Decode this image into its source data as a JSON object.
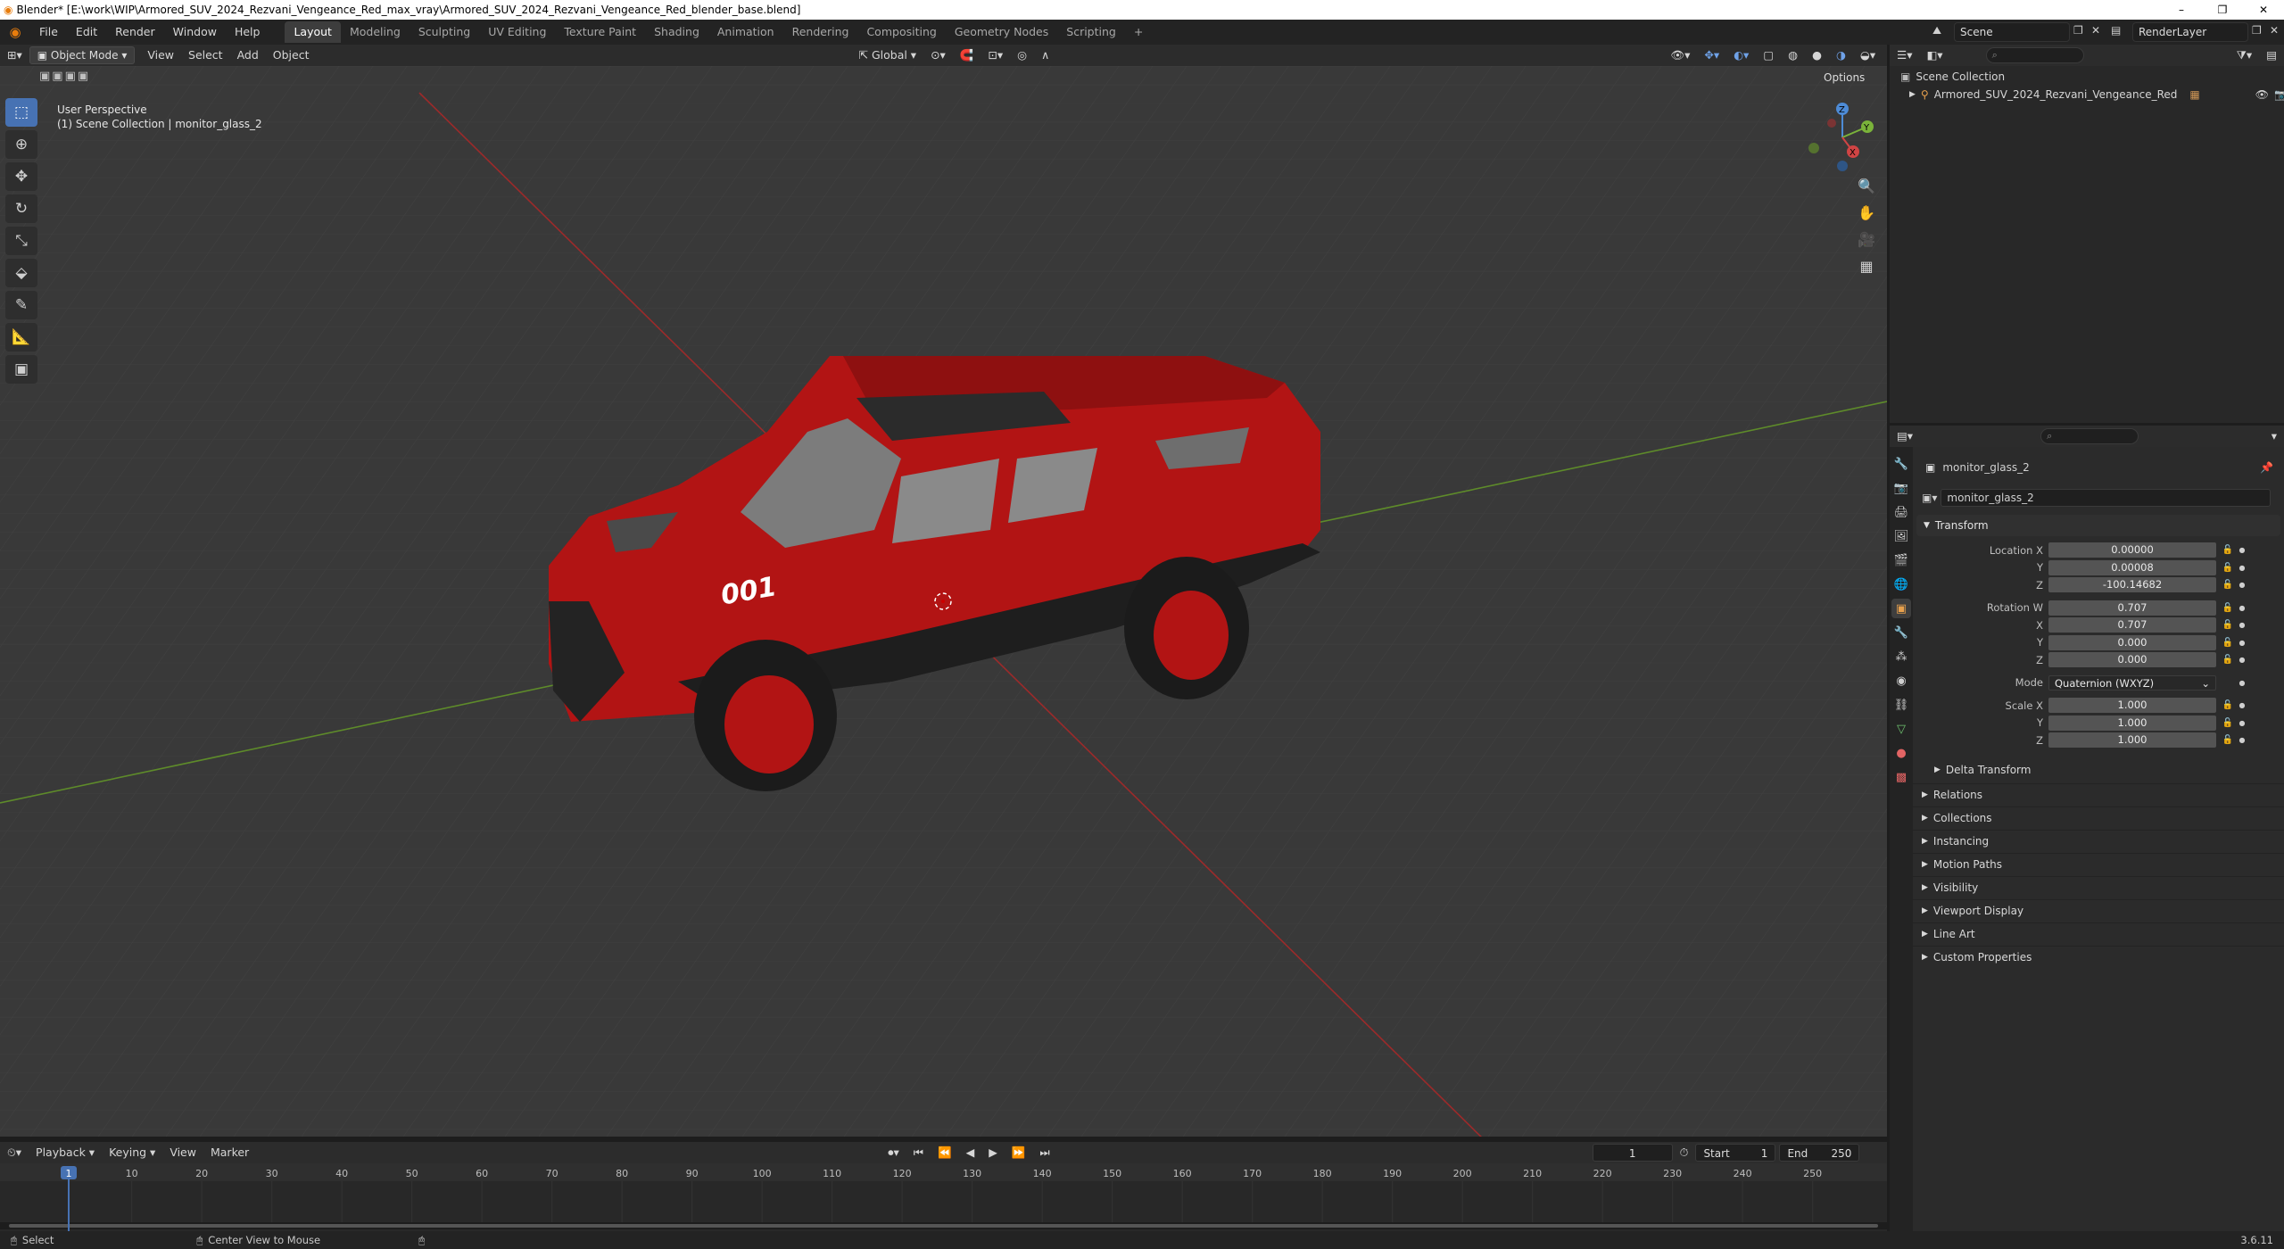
{
  "window": {
    "title": "Blender* [E:\\work\\WIP\\Armored_SUV_2024_Rezvani_Vengeance_Red_max_vray\\Armored_SUV_2024_Rezvani_Vengeance_Red_blender_base.blend]",
    "minimize": "–",
    "restore": "❐",
    "close": "✕"
  },
  "menu": [
    "File",
    "Edit",
    "Render",
    "Window",
    "Help"
  ],
  "workspaces": [
    "Layout",
    "Modeling",
    "Sculpting",
    "UV Editing",
    "Texture Paint",
    "Shading",
    "Animation",
    "Rendering",
    "Compositing",
    "Geometry Nodes",
    "Scripting"
  ],
  "workspace_add": "+",
  "scene": {
    "name": "Scene",
    "render_layer": "RenderLayer"
  },
  "viewport_header": {
    "mode": "Object Mode",
    "menus": [
      "View",
      "Select",
      "Add",
      "Object"
    ],
    "transform_orientation": "Global",
    "options": "Options"
  },
  "viewport": {
    "perspective": "User Perspective",
    "collection_info": "(1) Scene Collection | monitor_glass_2",
    "car_number": "001",
    "gizmo": {
      "x": "X",
      "y": "Y",
      "z": "Z"
    }
  },
  "outliner": {
    "root": "Scene Collection",
    "items": [
      "Armored_SUV_2024_Rezvani_Vengeance_Red"
    ]
  },
  "properties": {
    "object_name": "monitor_glass_2",
    "data_name": "monitor_glass_2",
    "transform_title": "Transform",
    "location": {
      "label_x": "Location X",
      "label_y": "Y",
      "label_z": "Z",
      "x": "0.00000",
      "y": "0.00008",
      "z": "-100.14682"
    },
    "rotation": {
      "label_w": "Rotation W",
      "label_x": "X",
      "label_y": "Y",
      "label_z": "Z",
      "w": "0.707",
      "x": "0.707",
      "y": "0.000",
      "z": "0.000"
    },
    "mode": {
      "label": "Mode",
      "value": "Quaternion (WXYZ)"
    },
    "scale": {
      "label_x": "Scale X",
      "label_y": "Y",
      "label_z": "Z",
      "x": "1.000",
      "y": "1.000",
      "z": "1.000"
    },
    "delta_transform": "Delta Transform",
    "panels": [
      "Relations",
      "Collections",
      "Instancing",
      "Motion Paths",
      "Visibility",
      "Viewport Display",
      "Line Art",
      "Custom Properties"
    ]
  },
  "timeline": {
    "menus": [
      "Playback",
      "Keying",
      "View",
      "Marker"
    ],
    "current_frame": "1",
    "start_label": "Start",
    "start": "1",
    "end_label": "End",
    "end": "250",
    "ticks": [
      "10",
      "20",
      "30",
      "40",
      "50",
      "60",
      "70",
      "80",
      "90",
      "100",
      "110",
      "120",
      "130",
      "140",
      "150",
      "160",
      "170",
      "180",
      "190",
      "200",
      "210",
      "220",
      "230",
      "240",
      "250"
    ],
    "playhead": "1"
  },
  "statusbar": {
    "select": "Select",
    "center": "Center View to Mouse",
    "version": "3.6.11"
  },
  "colors": {
    "car_red": "#b21414",
    "accent_blue": "#4772b3",
    "axis_red": "#9c2a2a",
    "axis_green": "#5e8b2a"
  }
}
